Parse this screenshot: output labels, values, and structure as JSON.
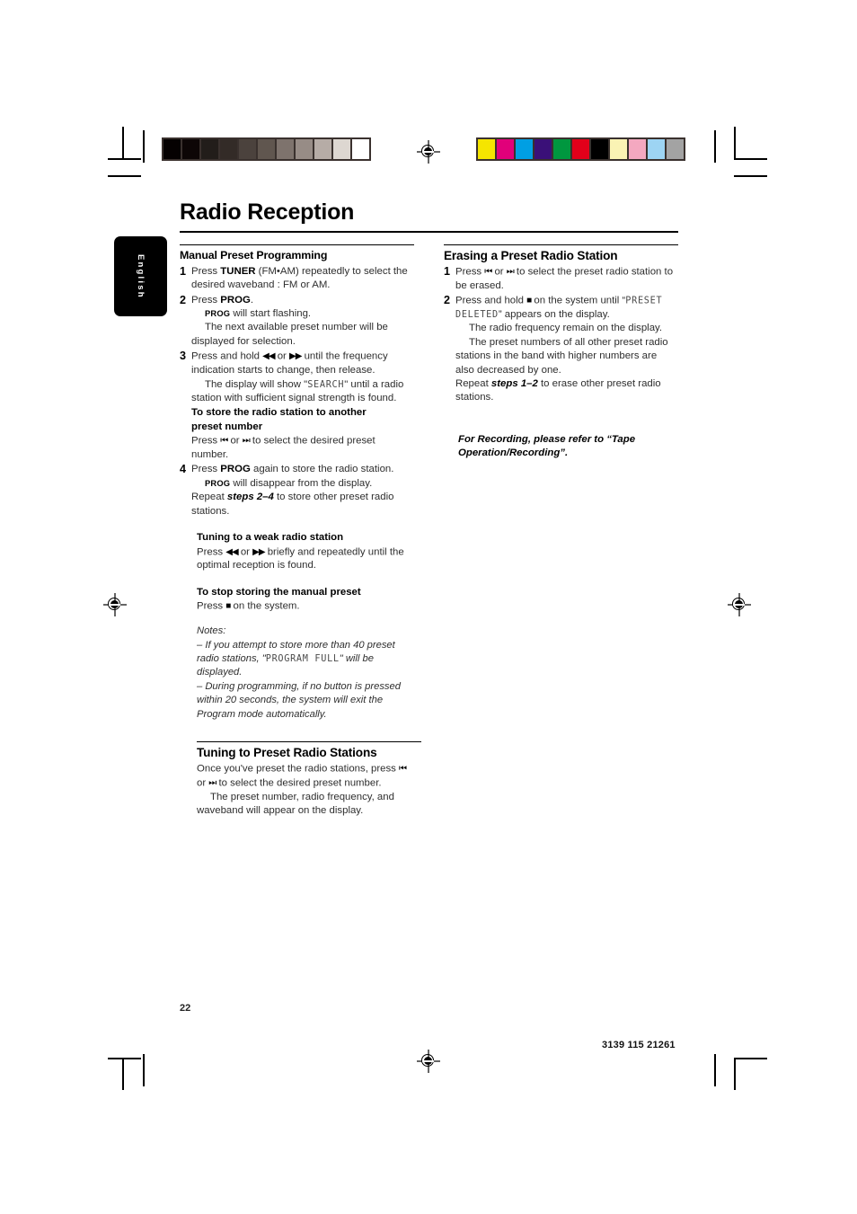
{
  "page": {
    "title": "Radio Reception",
    "language_tab": "English",
    "page_number": "22",
    "document_code": "3139 115 21261"
  },
  "calibration": {
    "grayscale_bar": {
      "name": "grayscale-calibration-bar",
      "swatches": [
        "#050101",
        "#0d0606",
        "#221d1a",
        "#332b27",
        "#4b423d",
        "#60564f",
        "#7e736d",
        "#978c86",
        "#b6aca6",
        "#ddd7d1",
        "#ffffff"
      ]
    },
    "color_bar": {
      "name": "color-calibration-bar",
      "swatches": [
        "#f5e500",
        "#e1007a",
        "#009fe3",
        "#3a1078",
        "#00973f",
        "#e2001a",
        "#000000",
        "#faf3b4",
        "#f4a8c0",
        "#9dd4f3",
        "#a3a3a3"
      ]
    }
  },
  "left_column": {
    "manual_preset": {
      "heading": "Manual Preset Programming",
      "step1": {
        "num": "1",
        "t1": "Press ",
        "b1": "TUNER",
        "t2": " (FM•AM) repeatedly to select the desired waveband : FM or AM."
      },
      "step2": {
        "num": "2",
        "t1": "Press ",
        "b1": "PROG",
        "t2": ".",
        "sub1_bold": "PROG",
        "sub1_text": " will start flashing.",
        "sub2_text": "The next available preset number will be displayed for selection."
      },
      "step3": {
        "num": "3",
        "t1": "Press and hold ",
        "g1": "◀◀",
        "t2": " or ",
        "g2": "▶▶",
        "t3": " until the frequency indication starts to change, then release.",
        "sub1_pre": "The display will show \"",
        "sub1_lcd": "SEARCH",
        "sub1_post": "\" until a radio station with sufficient signal strength is found."
      },
      "store_another": {
        "heading_line1": "To store the radio station to another",
        "heading_line2": "preset number",
        "t1": "Press ",
        "g1": "⏮",
        "t2": " or ",
        "g2": "⏭",
        "t3": " to select the desired preset number."
      },
      "step4": {
        "num": "4",
        "t1": "Press ",
        "b1": "PROG",
        "t2": " again to store the radio station.",
        "sub1_bold": "PROG",
        "sub1_text": " will disappear from the display.",
        "repeat_pre": "Repeat ",
        "repeat_bold": "steps 2–4",
        "repeat_post": " to store other preset radio stations."
      }
    },
    "weak_station": {
      "heading": "Tuning to a weak radio station",
      "t1": "Press ",
      "g1": "◀◀",
      "t2": " or ",
      "g2": "▶▶",
      "t3": " briefly and repeatedly until the optimal reception is found."
    },
    "stop_storing": {
      "heading": "To stop storing the manual preset",
      "t1": "Press ",
      "g1": "■",
      "t2": " on the system."
    },
    "notes": {
      "title": "Notes:",
      "note1_pre": "–  If you attempt to store more than 40 preset radio stations, \"",
      "note1_lcd": "PROGRAM FULL",
      "note1_post": "\" will be displayed.",
      "note2": "–  During programming, if no button is pressed within 20 seconds, the system will exit the Program mode automatically."
    },
    "tuning_preset": {
      "heading": "Tuning to Preset Radio Stations",
      "t1": "Once you've preset the radio stations, press ",
      "g1": "⏮",
      "t2": " or ",
      "g2": "⏭",
      "t3": " to select the desired preset number.",
      "sub1": "The preset number, radio frequency, and waveband will appear on the display."
    }
  },
  "right_column": {
    "erasing": {
      "heading": "Erasing a Preset Radio Station",
      "step1": {
        "num": "1",
        "t1": "Press ",
        "g1": "⏮",
        "t2": " or ",
        "g2": "⏭",
        "t3": " to select the preset radio station to be erased."
      },
      "step2": {
        "num": "2",
        "t1": "Press and hold ",
        "g1": "■",
        "t2": " on the system until “",
        "lcd1": "PRESET DELETED",
        "t3": "” appears on the display.",
        "sub1": "The radio frequency remain on the display.",
        "sub2": "The preset numbers of all other preset radio stations in the band with higher numbers are also decreased by one.",
        "repeat_pre": "Repeat ",
        "repeat_bold": "steps 1–2",
        "repeat_post": " to erase other preset radio stations."
      }
    },
    "recording_note": {
      "line1": "For Recording, please refer to “Tape",
      "line2": "Operation/Recording”."
    }
  }
}
